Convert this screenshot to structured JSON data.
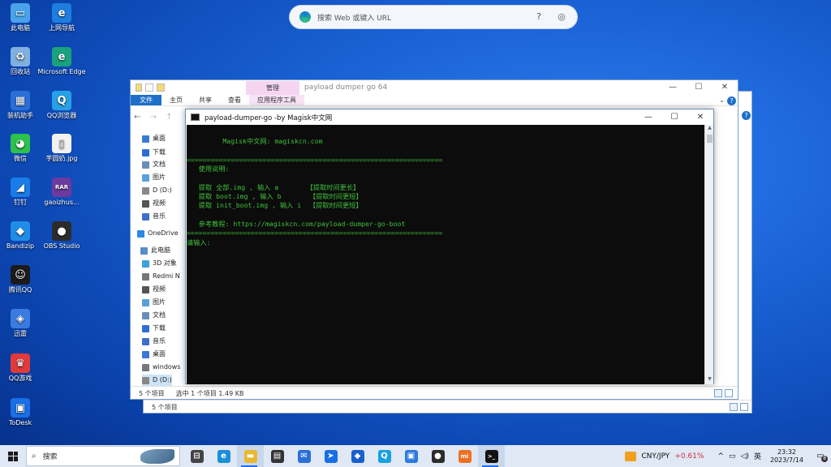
{
  "desktop": {
    "icons": [
      {
        "label": "此电脑",
        "color": "#4aa3ea",
        "glyph": "▭"
      },
      {
        "label": "上网导航",
        "color": "#1f7de0",
        "glyph": "e"
      },
      {
        "label": "回收站",
        "color": "#7fb0df",
        "glyph": "♻"
      },
      {
        "label": "Microsoft Edge",
        "color": "#1aa17d",
        "glyph": "e"
      },
      {
        "label": "装机助手",
        "color": "#2a6fd8",
        "glyph": "▦"
      },
      {
        "label": "QQ浏览器",
        "color": "#27a1e6",
        "glyph": "Q"
      },
      {
        "label": "微信",
        "color": "#2dc24b",
        "glyph": "◕"
      },
      {
        "label": "芋圆奶.jpg",
        "color": "#f2f2f2",
        "glyph": "▯"
      },
      {
        "label": "钉钉",
        "color": "#1a7ce8",
        "glyph": "◢"
      },
      {
        "label": "gaoizhus...",
        "color": "#6d3aa0",
        "glyph": "RAR"
      },
      {
        "label": "Bandizip",
        "color": "#1f8de8",
        "glyph": "◆"
      },
      {
        "label": "OBS Studio",
        "color": "#2c2c2c",
        "glyph": "●"
      },
      {
        "label": "腾讯QQ",
        "color": "#1b1b1b",
        "glyph": "☺"
      },
      {
        "label": "迅雷",
        "color": "#3a7be0",
        "glyph": "◈"
      },
      {
        "label": "QQ游戏",
        "color": "#e03a3a",
        "glyph": "♛"
      },
      {
        "label": "ToDesk",
        "color": "#1a6ee6",
        "glyph": "▣"
      }
    ]
  },
  "browser_search": {
    "placeholder": "搜索 Web 或键入 URL"
  },
  "explorer": {
    "manage_tab": "管理",
    "title": "payload dumper go 64",
    "ribbon": [
      "文件",
      "主页",
      "共享",
      "查看",
      "应用程序工具"
    ],
    "nav_items": [
      "桌面",
      "下载",
      "文档",
      "图片",
      "D (D:)",
      "视频",
      "音乐",
      "OneDrive",
      "此电脑",
      "3D 对象",
      "Redmi N",
      "视频",
      "图片",
      "文档",
      "下载",
      "音乐",
      "桌面",
      "windows",
      "D (D:)"
    ],
    "status_count": "5 个项目",
    "status_selected": "选中 1 个项目 1.49 KB"
  },
  "explorer_back": {
    "status_count": "5 个项目"
  },
  "console": {
    "title": "payload-dumper-go -by Magisk中文网",
    "lines": [
      "",
      "         Magisk中文网: magiskcn.com",
      "",
      "================================================================",
      "   使用说明:",
      "",
      "   提取 全部.img , 输入 a       【提取时间更长】",
      "   提取 boot.img , 输入 b       【提取时间更短】",
      "   提取 init_boot.img , 输入 i  【提取时间更短】",
      "",
      "   参考教程: https://magiskcn.com/payload-dumper-go-boot",
      "================================================================",
      "请输入:"
    ]
  },
  "taskbar": {
    "search_placeholder": "搜索",
    "apps": [
      "task-view",
      "edge",
      "file-explorer",
      "store",
      "mail",
      "app-blue",
      "app-blue2",
      "qq-browser",
      "app-todesk",
      "obs",
      "mi",
      "terminal"
    ],
    "stock_name": "CNY/JPY",
    "stock_change": "+0.61%",
    "ime": "英",
    "time": "23:32",
    "date": "2023/7/14",
    "notifications": "8"
  }
}
